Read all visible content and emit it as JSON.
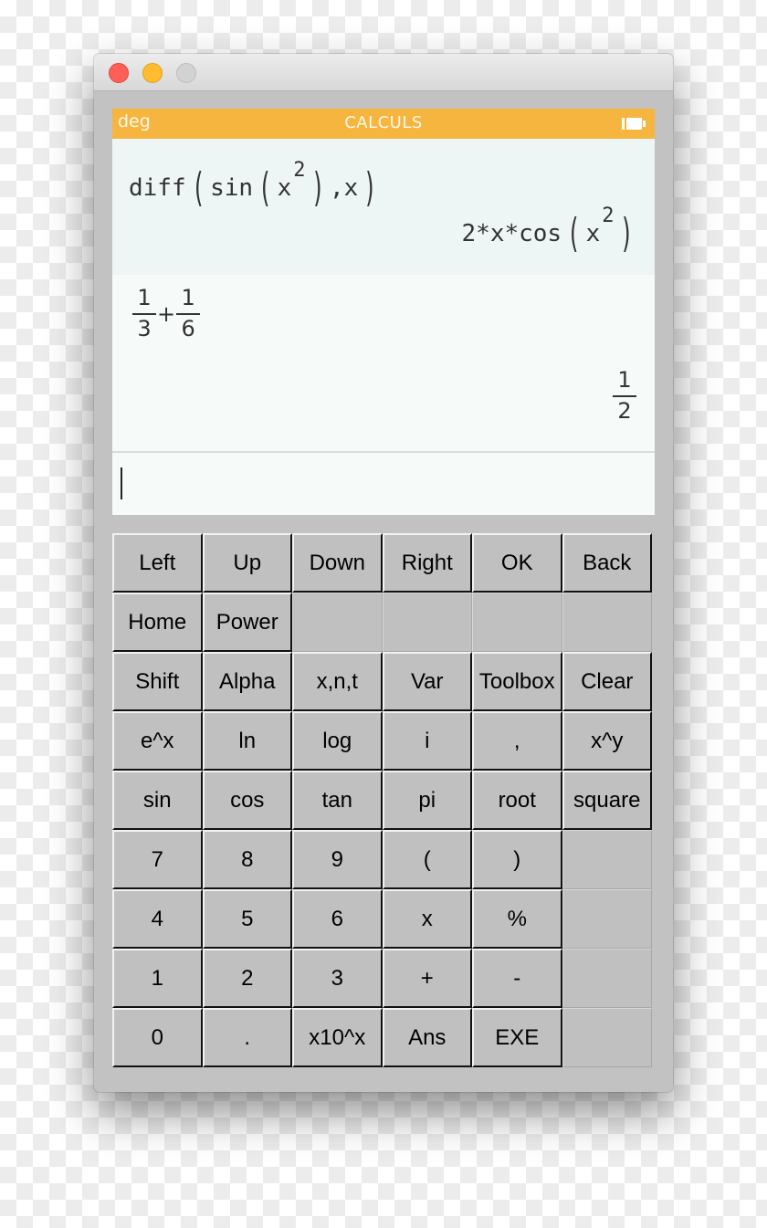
{
  "window": {
    "controls": [
      {
        "name": "close",
        "color": "#fe5f57"
      },
      {
        "name": "minimize",
        "color": "#febc2e"
      },
      {
        "name": "zoom",
        "color": "#d2d2d2"
      }
    ]
  },
  "header": {
    "mode": "deg",
    "title": "CALCULS",
    "battery_icon": "battery-full-icon",
    "color": "#f6b53f"
  },
  "history": [
    {
      "input": {
        "fn": "diff",
        "inner_fn": "sin",
        "base": "x",
        "exponent": "2",
        "arg2": "x",
        "text": "diff(sin(x^2),x)"
      },
      "output": {
        "prefix": "2*x*cos",
        "base": "x",
        "exponent": "2",
        "text": "2*x*cos(x^2)"
      }
    },
    {
      "input": {
        "frac1_num": "1",
        "frac1_den": "3",
        "operator": "+",
        "frac2_num": "1",
        "frac2_den": "6",
        "text": "1/3+1/6"
      },
      "output": {
        "num": "1",
        "den": "2",
        "text": "1/2"
      }
    }
  ],
  "input": {
    "value": ""
  },
  "keypad": {
    "rows": [
      [
        "Left",
        "Up",
        "Down",
        "Right",
        "OK",
        "Back"
      ],
      [
        "Home",
        "Power",
        "",
        "",
        "",
        ""
      ],
      [
        "Shift",
        "Alpha",
        "x,n,t",
        "Var",
        "Toolbox",
        "Clear"
      ],
      [
        "e^x",
        "ln",
        "log",
        "i",
        ",",
        "x^y"
      ],
      [
        "sin",
        "cos",
        "tan",
        "pi",
        "root",
        "square"
      ],
      [
        "7",
        "8",
        "9",
        "(",
        ")",
        ""
      ],
      [
        "4",
        "5",
        "6",
        "x",
        "%",
        ""
      ],
      [
        "1",
        "2",
        "3",
        "+",
        "-",
        ""
      ],
      [
        "0",
        ".",
        "x10^x",
        "Ans",
        "EXE",
        ""
      ]
    ]
  }
}
